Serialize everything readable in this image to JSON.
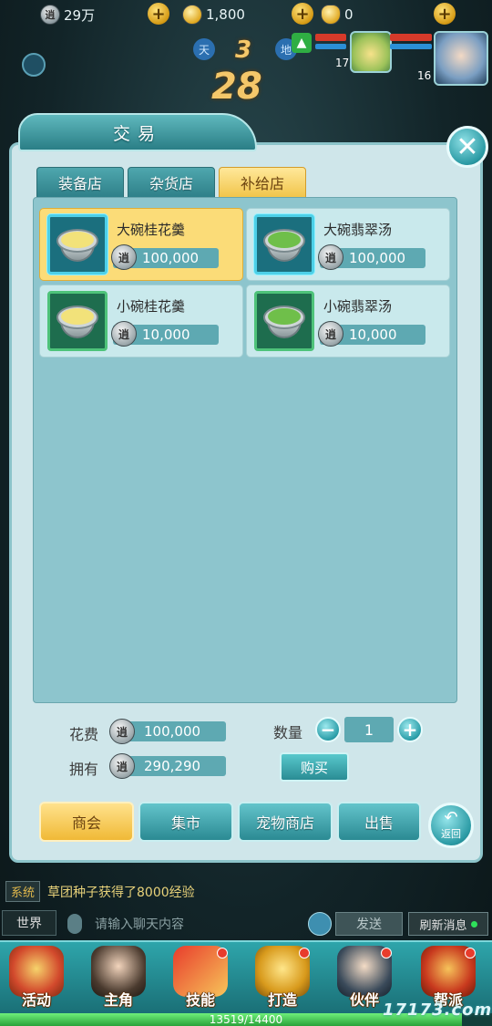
{
  "resources": {
    "silver": "29万",
    "gold": "1,800",
    "ingot": "0"
  },
  "hud": {
    "left_badge": "天",
    "right_badge": "地",
    "round": "3",
    "timer": "28",
    "player_levels": [
      "17",
      "16"
    ]
  },
  "dialog": {
    "title": "交易",
    "tabs": [
      "装备店",
      "杂货店",
      "补给店"
    ],
    "active_tab": 2,
    "items": [
      {
        "name": "大碗桂花羹",
        "price": "100,000",
        "soup": "#f2e27a",
        "frame": "blue",
        "selected": true
      },
      {
        "name": "大碗翡翠汤",
        "price": "100,000",
        "soup": "#6fbf4a",
        "frame": "blue",
        "selected": false
      },
      {
        "name": "小碗桂花羹",
        "price": "10,000",
        "soup": "#f2e27a",
        "frame": "green",
        "selected": false
      },
      {
        "name": "小碗翡翠汤",
        "price": "10,000",
        "soup": "#6fbf4a",
        "frame": "green",
        "selected": false
      }
    ],
    "coin_glyph": "逍",
    "cost_label": "花费",
    "cost_value": "100,000",
    "own_label": "拥有",
    "own_value": "290,290",
    "qty_label": "数量",
    "qty_value": "1",
    "buy_label": "购买",
    "shop_buttons": [
      "商会",
      "集市",
      "宠物商店",
      "出售"
    ],
    "active_shop": 0,
    "back_label": "返回"
  },
  "chat": {
    "system_tag": "系统",
    "system_message": "草团种子获得了8000经验",
    "channel": "世界",
    "input_placeholder": "请输入聊天内容",
    "send_label": "发送",
    "refresh_label": "刷新消息"
  },
  "nav": [
    {
      "label": "活动",
      "badge": false
    },
    {
      "label": "主角",
      "badge": false
    },
    {
      "label": "技能",
      "badge": true
    },
    {
      "label": "打造",
      "badge": true
    },
    {
      "label": "伙伴",
      "badge": true
    },
    {
      "label": "帮派",
      "badge": true
    }
  ],
  "exp": {
    "current": 13519,
    "max": 14400,
    "text": "13519/14400"
  },
  "watermark": "17173.com",
  "colors": {
    "accent": "#2a9aa4",
    "selected": "#fbdc78",
    "panel": "#cfe6ea"
  }
}
